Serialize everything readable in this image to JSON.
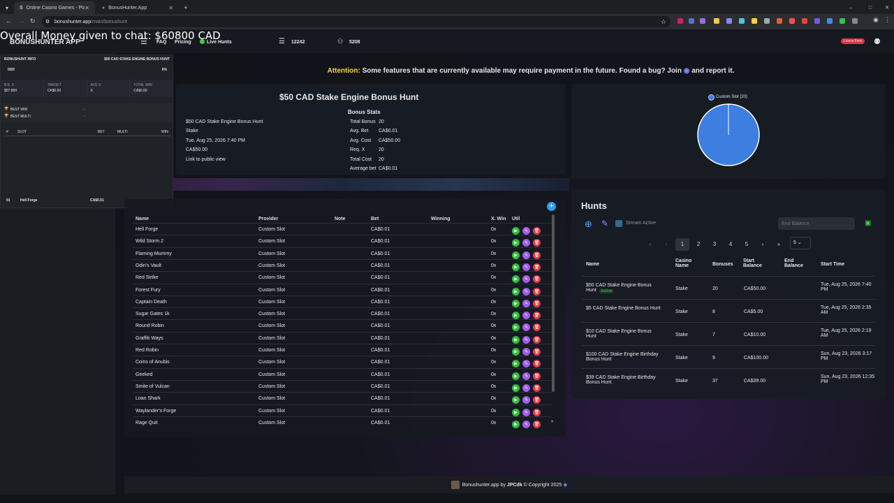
{
  "browser": {
    "tabs": [
      {
        "label": "Online Casino Games - Play Fre"
      },
      {
        "label": "BonusHunter.App"
      }
    ],
    "url_host": "bonushunter.app",
    "url_path": "/main/bonushunt"
  },
  "overlay": {
    "money_text": "Overall Money given to chat: $60800 CAD"
  },
  "nav": {
    "brand": "BONUSHUNTER APP",
    "faq": "FAQ",
    "pricing": "Pricing",
    "live_hunts": "Live Hunts",
    "stat1": "12242",
    "stat2": "5208",
    "license_badge": "Licens Free"
  },
  "bonushunt_info": {
    "title": "BONUSHUNT INFO",
    "hunt_name": "$50 CAD STAKE ENGINE BONUS HUNT",
    "progress": "0/20",
    "percent": "0%",
    "be_label": "B.E. X",
    "be_value": "$57.89X",
    "target_label": "TARGET",
    "target_value": "CA$0.00",
    "avgx_label": "AVG X",
    "avgx_value": "X",
    "totalwin_label": "TOTAL WIN",
    "totalwin_value": "CA$0.00",
    "best_win": "BEST WIN",
    "best_multi": "BEST MULTI",
    "best_win_val": "-",
    "best_multi_val": "-",
    "col_num": "#",
    "col_slot": "SLOT",
    "col_bet": "BET",
    "col_multi": "MULTI",
    "col_win": "WIN",
    "row_num": "01",
    "row_slot": "Hell Forge",
    "row_bet": "CA$0.01"
  },
  "attention": {
    "label": "Attention:",
    "text": "Some features that are currently available may require payment in the future. Found a bug? Join",
    "tail": "and report it."
  },
  "stats": {
    "title": "$50 CAD Stake Engine Bonus Hunt",
    "left": [
      "$50 CAD Stake Engine Bonus Hunt",
      "Stake",
      "Tue, Aug 25, 2026 7:40 PM",
      "CA$50.00",
      "Link to public view"
    ],
    "heading": "Bonus Stats",
    "rows": [
      [
        "Total Bonus",
        "20"
      ],
      [
        "Avg. Bet",
        "CA$0.01"
      ],
      [
        "Avg. Cost",
        "CA$50.00"
      ],
      [
        "Req. X",
        "20"
      ],
      [
        "Total Cost",
        "20"
      ],
      [
        "Average bet",
        "CA$0.01"
      ]
    ]
  },
  "pie": {
    "legend": "Custom Slot (20)",
    "color": "#3d7fe0"
  },
  "slots": {
    "headers": [
      "Name",
      "Provider",
      "Note",
      "Bet",
      "Winning",
      "X. Win",
      "Util"
    ],
    "rows": [
      [
        "Hell Forge",
        "Custom Slot",
        "CA$0.01",
        "0x"
      ],
      [
        "Wild Storm 2",
        "Custom Slot",
        "CA$0.01",
        "0x"
      ],
      [
        "Flaming Mummy",
        "Custom Slot",
        "CA$0.01",
        "0x"
      ],
      [
        "Odin's Vault",
        "Custom Slot",
        "CA$0.01",
        "0x"
      ],
      [
        "Red Strike",
        "Custom Slot",
        "CA$0.01",
        "0x"
      ],
      [
        "Forest Fury",
        "Custom Slot",
        "CA$0.01",
        "0x"
      ],
      [
        "Captain Death",
        "Custom Slot",
        "CA$0.01",
        "0x"
      ],
      [
        "Sugar Gates 1k",
        "Custom Slot",
        "CA$0.01",
        "0x"
      ],
      [
        "Round Robin",
        "Custom Slot",
        "CA$0.01",
        "0x"
      ],
      [
        "Graffiti Ways",
        "Custom Slot",
        "CA$0.01",
        "0x"
      ],
      [
        "Red Robin",
        "Custom Slot",
        "CA$0.01",
        "0x"
      ],
      [
        "Coins of Anubis",
        "Custom Slot",
        "CA$0.01",
        "0x"
      ],
      [
        "Geeked",
        "Custom Slot",
        "CA$0.01",
        "0x"
      ],
      [
        "Smite of Vulcan",
        "Custom Slot",
        "CA$0.01",
        "0x"
      ],
      [
        "Loan Shark",
        "Custom Slot",
        "CA$0.01",
        "0x"
      ],
      [
        "Waylander's Forge",
        "Custom Slot",
        "CA$0.01",
        "0x"
      ],
      [
        "Rage Quit",
        "Custom Slot",
        "CA$0.01",
        "0x"
      ]
    ]
  },
  "hunts": {
    "title": "Hunts",
    "stream_active": "Stream Active",
    "end_balance_placeholder": "End Balance",
    "pages": [
      "«",
      "‹",
      "1",
      "2",
      "3",
      "4",
      "5",
      "›",
      "»"
    ],
    "page_size": "5",
    "headers": [
      "Name",
      "Casino Name",
      "Bonuses",
      "Start Balance",
      "End Balance",
      "Start Time"
    ],
    "active_badge": "Active",
    "rows": [
      [
        "$50 CAD Stake Engine Bonus Hunt",
        "Stake",
        "20",
        "CA$50.00",
        "",
        "Tue, Aug 25, 2026 7:40 PM"
      ],
      [
        "$5 CAD Stake Engine Bonus Hunt",
        "Stake",
        "8",
        "CA$5.00",
        "",
        "Tue, Aug 25, 2026 2:35 AM"
      ],
      [
        "$10 CAD Stake Engine Bonus Hunt",
        "Stake",
        "7",
        "CA$10.00",
        "",
        "Tue, Aug 25, 2026 2:19 AM"
      ],
      [
        "$100 CAD Stake Engine Birthday Bonus Hunt",
        "Stake",
        "9",
        "CA$100.00",
        "",
        "Sun, Aug 23, 2026 3:17 PM"
      ],
      [
        "$39 CAD Stake Engine Birthday Bonus Hunt",
        "Stake",
        "37",
        "CA$39.00",
        "",
        "Sun, Aug 23, 2026 12:35 PM"
      ]
    ]
  },
  "footer": {
    "text": "Bonushunter.app by",
    "author": "JPCdk",
    "copyright": "© Copyright 2025"
  },
  "colors": {
    "accent_green": "#3ecf4a",
    "util_play": "#2fbf3c",
    "util_edit": "#a05cf0",
    "util_delete": "#e53a4a",
    "add_blue": "#2e9fe8"
  }
}
